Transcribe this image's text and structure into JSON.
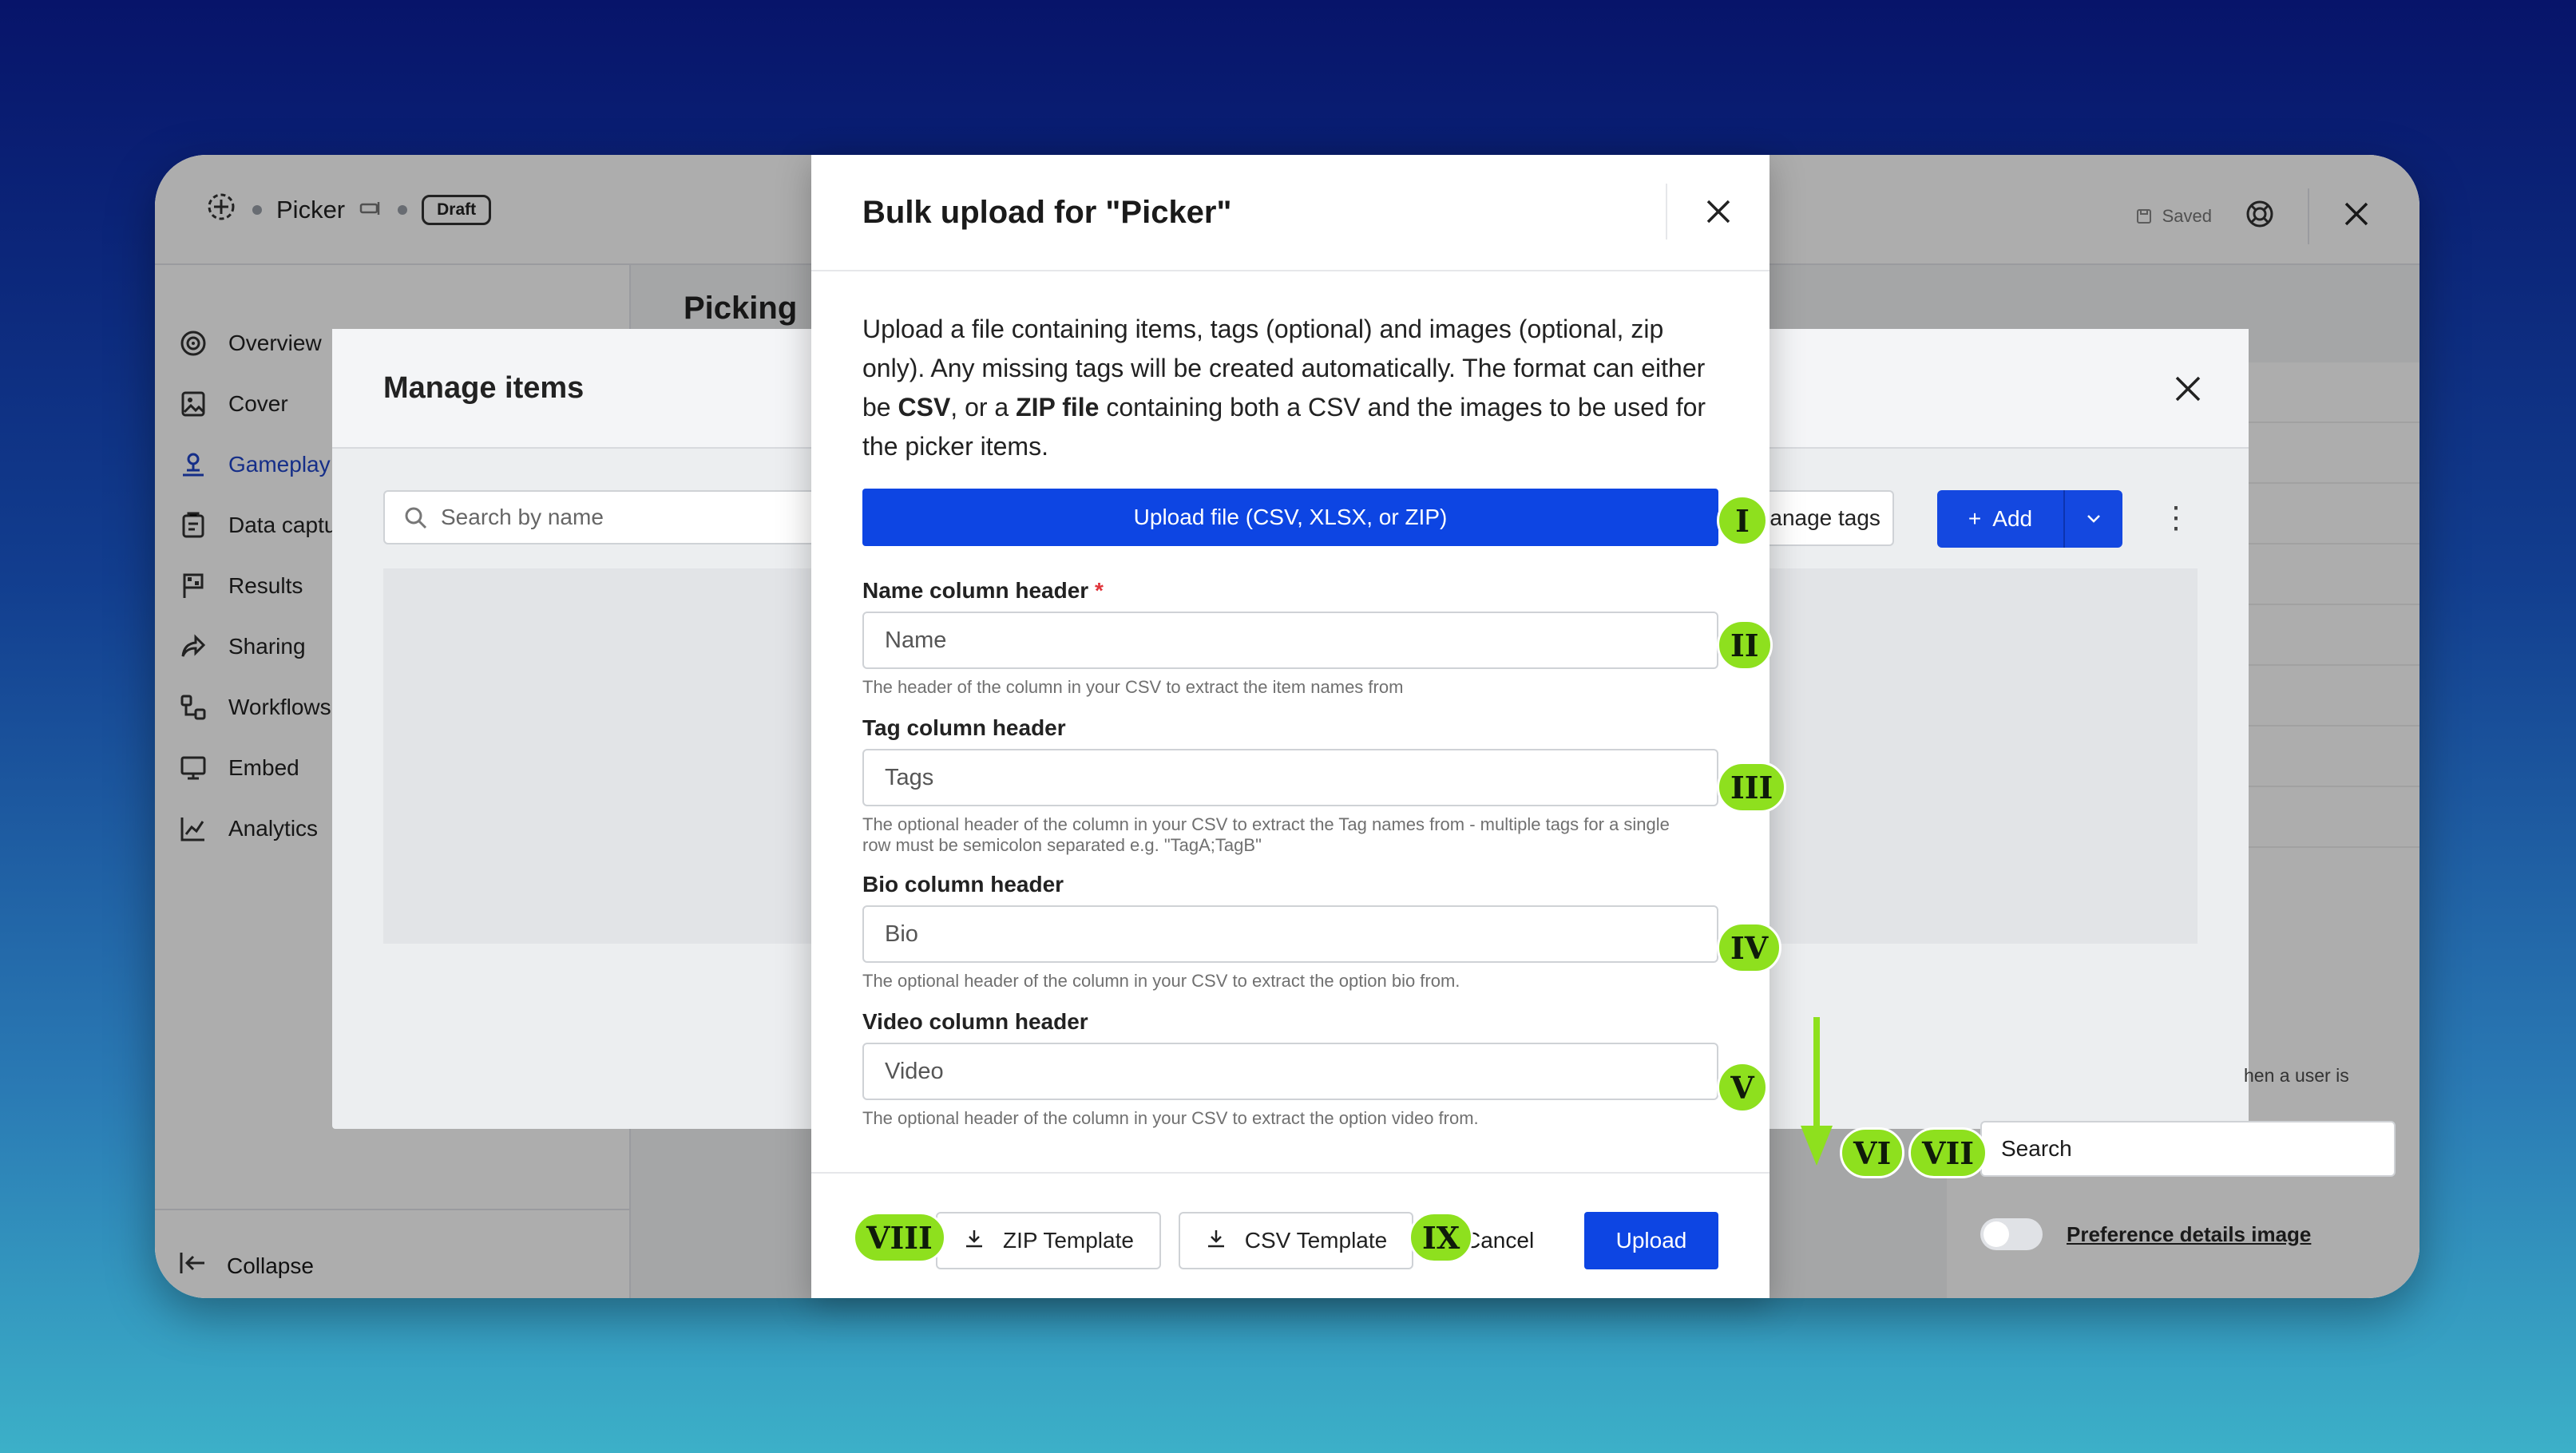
{
  "app": {
    "name": "Picker",
    "status": "Draft",
    "saved_label": "Saved",
    "page_title": "Picking",
    "sidebar": [
      {
        "label": "Overview",
        "icon": "target-icon"
      },
      {
        "label": "Cover",
        "icon": "image-icon"
      },
      {
        "label": "Gameplay",
        "icon": "user-stand-icon"
      },
      {
        "label": "Data captu",
        "icon": "clipboard-icon"
      },
      {
        "label": "Results",
        "icon": "flag-icon"
      },
      {
        "label": "Sharing",
        "icon": "share-icon"
      },
      {
        "label": "Workflows",
        "icon": "workflow-icon"
      },
      {
        "label": "Embed",
        "icon": "monitor-icon"
      },
      {
        "label": "Analytics",
        "icon": "chart-icon"
      }
    ],
    "collapse_label": "Collapse",
    "right_partial_text": "hen a user is",
    "right_search_value": "Search",
    "pref_label": "Preference details image"
  },
  "manage": {
    "title": "Manage items",
    "search_placeholder": "Search by name",
    "tags_button": "Manage tags",
    "add_button": "Add"
  },
  "dialog": {
    "title": "Bulk upload for \"Picker\"",
    "intro_1": "Upload a file containing items, tags (optional) and images (optional, zip only). Any missing tags will be created automatically. The format can either be ",
    "intro_csv": "CSV",
    "intro_2": ", or a ",
    "intro_zip": "ZIP file",
    "intro_3": " containing both a CSV and the images to be used for the picker items.",
    "upload_file_button": "Upload file (CSV, XLSX, or ZIP)",
    "fields": [
      {
        "label": "Name column header",
        "required": "*",
        "placeholder": "Name",
        "help": "The header of the column in your CSV to extract the item names from"
      },
      {
        "label": "Tag column header",
        "placeholder": "Tags",
        "help": "The optional header of the column in your CSV to extract the Tag names from - multiple tags for a single row must be semicolon separated e.g. \"TagA;TagB\""
      },
      {
        "label": "Bio column header",
        "placeholder": "Bio",
        "help": "The optional header of the column in your CSV to extract the option bio from."
      },
      {
        "label": "Video column header",
        "placeholder": "Video",
        "help": "The optional header of the column in your CSV to extract the option video from."
      }
    ],
    "zip_template": "ZIP Template",
    "csv_template": "CSV Template",
    "cancel": "Cancel",
    "upload": "Upload"
  },
  "badges": [
    "I",
    "II",
    "III",
    "IV",
    "V",
    "VI",
    "VII",
    "VIII",
    "IX"
  ],
  "colors": {
    "primary": "#0d45e3",
    "badge": "#8ee01e",
    "required": "#e0343a"
  }
}
